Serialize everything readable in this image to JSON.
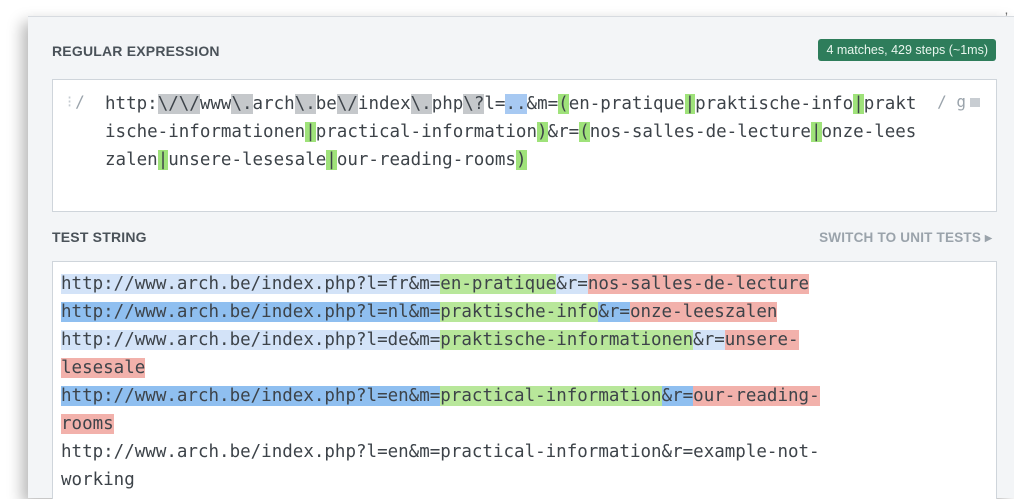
{
  "regex_section": {
    "label": "REGULAR EXPRESSION",
    "badge": "4 matches, 429 steps (~1ms)",
    "delimiter_open": "/",
    "flags": "/ g",
    "tokens": [
      {
        "t": "http:",
        "k": "lit"
      },
      {
        "t": "\\/",
        "k": "esc"
      },
      {
        "t": "\\/",
        "k": "esc"
      },
      {
        "t": "www",
        "k": "lit"
      },
      {
        "t": "\\.",
        "k": "esc"
      },
      {
        "t": "arch",
        "k": "lit"
      },
      {
        "t": "\\.",
        "k": "esc"
      },
      {
        "t": "be",
        "k": "lit"
      },
      {
        "t": "\\/",
        "k": "esc"
      },
      {
        "t": "index",
        "k": "lit"
      },
      {
        "t": "\\.",
        "k": "esc"
      },
      {
        "t": "php",
        "k": "lit"
      },
      {
        "t": "\\?",
        "k": "esc"
      },
      {
        "t": "l=",
        "k": "lit"
      },
      {
        "t": "..",
        "k": "any"
      },
      {
        "t": "&m=",
        "k": "lit"
      },
      {
        "t": "(",
        "k": "grp"
      },
      {
        "t": "en-pratique",
        "k": "lit"
      },
      {
        "t": "|",
        "k": "alt"
      },
      {
        "t": "praktische-info",
        "k": "lit"
      },
      {
        "t": "|",
        "k": "alt"
      },
      {
        "t": "praktische-informationen",
        "k": "lit"
      },
      {
        "t": "|",
        "k": "alt"
      },
      {
        "t": "practical-information",
        "k": "lit"
      },
      {
        "t": ")",
        "k": "grp"
      },
      {
        "t": "&r=",
        "k": "lit"
      },
      {
        "t": "(",
        "k": "grp"
      },
      {
        "t": "nos-salles-de-lecture",
        "k": "lit"
      },
      {
        "t": "|",
        "k": "alt"
      },
      {
        "t": "onze-leeszalen",
        "k": "lit"
      },
      {
        "t": "|",
        "k": "alt"
      },
      {
        "t": "unsere-lesesale",
        "k": "lit"
      },
      {
        "t": "|",
        "k": "alt"
      },
      {
        "t": "our-reading-rooms",
        "k": "lit"
      },
      {
        "t": ")",
        "k": "grp"
      }
    ]
  },
  "test_section": {
    "label": "TEST STRING",
    "switch_label": "SWITCH TO UNIT TESTS ▸",
    "lines": [
      {
        "segs": [
          {
            "t": "http://www.arch.be/index.php?l=fr&m=",
            "c": "url-a"
          },
          {
            "t": "en-pratique",
            "c": "g1"
          },
          {
            "t": "&r=",
            "c": "sep-a"
          },
          {
            "t": "nos-salles-de-lecture",
            "c": "g2"
          }
        ]
      },
      {
        "segs": [
          {
            "t": "http://www.arch.be/index.php?l=nl&m=",
            "c": "url-b"
          },
          {
            "t": "praktische-info",
            "c": "g1"
          },
          {
            "t": "&r=",
            "c": "sep-b"
          },
          {
            "t": "onze-leeszalen",
            "c": "g2"
          }
        ]
      },
      {
        "segs": [
          {
            "t": "http://www.arch.be/index.php?l=de&m=",
            "c": "url-a"
          },
          {
            "t": "praktische-informationen",
            "c": "g1"
          },
          {
            "t": "&r=",
            "c": "sep-a"
          },
          {
            "t": "unsere-",
            "c": "g2"
          }
        ]
      },
      {
        "segs": [
          {
            "t": "lesesale",
            "c": "g2"
          }
        ]
      },
      {
        "segs": [
          {
            "t": "http://www.arch.be/index.php?l=en&m=",
            "c": "url-b"
          },
          {
            "t": "practical-information",
            "c": "g1"
          },
          {
            "t": "&r=",
            "c": "sep-b"
          },
          {
            "t": "our-reading-",
            "c": "g2"
          }
        ]
      },
      {
        "segs": [
          {
            "t": "rooms",
            "c": "g2"
          }
        ]
      },
      {
        "segs": [
          {
            "t": "http://www.arch.be/index.php?l=en&m=practical-information&r=example-not-",
            "c": ""
          }
        ]
      },
      {
        "segs": [
          {
            "t": "working",
            "c": ""
          }
        ]
      }
    ]
  },
  "icons": {
    "flag": "flag-icon",
    "grip": "drag-handle-icon"
  },
  "colors": {
    "badge": "#2e7d5b",
    "group": "#9fe27a",
    "match_light": "#d3e3f8",
    "match_dark": "#8fbff0",
    "group2": "#f2b1ab"
  }
}
